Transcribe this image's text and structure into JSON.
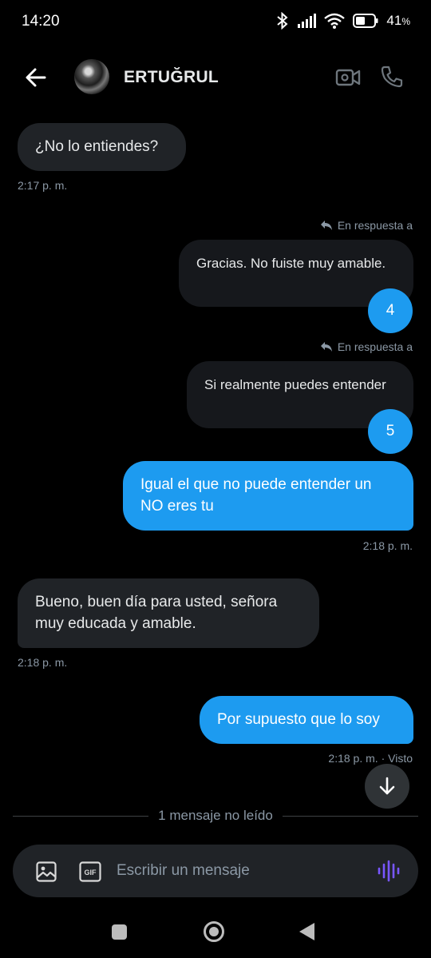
{
  "status": {
    "time": "14:20",
    "battery": "41",
    "battery_unit": "%"
  },
  "header": {
    "contact_name": "ERTUĞRUL"
  },
  "messages": [
    {
      "text": "¿No lo entiendes?",
      "time": "2:17 p. m."
    },
    {
      "reply_label": "En respuesta a",
      "text": "Gracias. No fuiste muy amable.",
      "reaction": "4"
    },
    {
      "reply_label": "En respuesta a",
      "text": "Si realmente puedes entender",
      "reaction": "5"
    },
    {
      "text": "Igual el que no puede entender un NO eres tu",
      "time": "2:18 p. m."
    },
    {
      "text": "Bueno, buen día para usted, señora muy educada y amable.",
      "time": "2:18 p. m."
    },
    {
      "text": "Por supuesto que lo soy",
      "time": "2:18 p. m. · Visto"
    }
  ],
  "unread_label": "1 mensaje no leído",
  "composer": {
    "placeholder": "Escribir un mensaje",
    "gif_label": "GIF"
  },
  "colors": {
    "accent": "#1d9bf0",
    "incoming": "#202327",
    "background": "#000000",
    "voice": "#7856ff"
  }
}
